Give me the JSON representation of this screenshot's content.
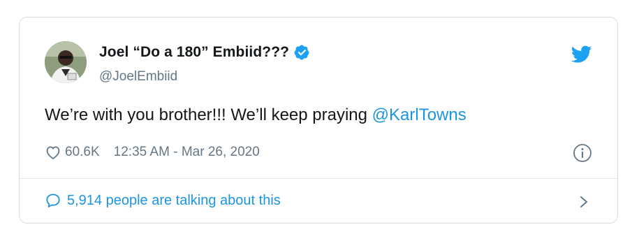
{
  "tweet": {
    "display_name": "Joel “Do a 180” Embiid???",
    "handle": "@JoelEmbiid",
    "text_before": "We’re with you brother!!! We’ll keep praying ",
    "mention": "@KarlTowns",
    "likes": "60.6K",
    "timestamp": "12:35 AM - Mar 26, 2020",
    "talking": "5,914 people are talking about this"
  },
  "icons": {
    "verified": "verified-badge-icon",
    "bird": "twitter-bird-icon",
    "heart": "heart-icon",
    "info": "info-icon",
    "bubble": "speech-bubble-icon",
    "chevron": "chevron-right-icon"
  },
  "colors": {
    "accent": "#1b95e0",
    "text": "#14171a",
    "secondary": "#657786",
    "border": "#d3dbe2"
  }
}
